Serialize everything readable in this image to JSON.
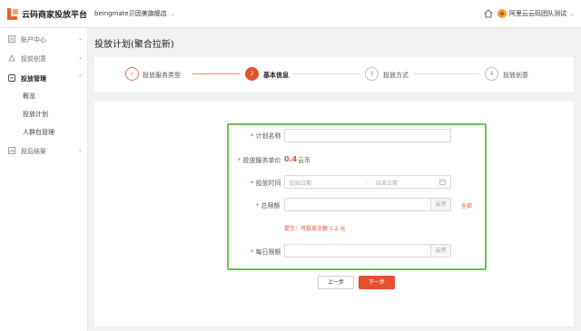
{
  "app": {
    "name": "云码商家投放平台"
  },
  "header": {
    "store_name": "beingmate贝因美旗舰店",
    "account_name": "阿里云云码团队测试"
  },
  "sidebar": {
    "groups": [
      {
        "label": "账户中心",
        "expanded": false
      },
      {
        "label": "投前创意",
        "expanded": false
      },
      {
        "label": "投放管理",
        "expanded": true,
        "items": [
          "概览",
          "投放计划",
          "人群包管理"
        ]
      },
      {
        "label": "投后结案",
        "expanded": false
      }
    ]
  },
  "page": {
    "title": "投放计划(聚合拉新)"
  },
  "steps": [
    {
      "number": "✓",
      "label": "投放服务类型",
      "status": "done"
    },
    {
      "number": "2",
      "label": "基本信息",
      "status": "current"
    },
    {
      "number": "3",
      "label": "投放方式",
      "status": "pending"
    },
    {
      "number": "4",
      "label": "投放创意",
      "status": "pending"
    }
  ],
  "form": {
    "plan_name": {
      "label": "计划名称",
      "value": ""
    },
    "unit_price": {
      "label": "投放服务单价",
      "value": "0.4",
      "unit": "云币"
    },
    "schedule": {
      "label": "投放时间",
      "start_placeholder": "起始日期",
      "separator": "-",
      "end_placeholder": "结束日期"
    },
    "total_limit": {
      "label": "总限额",
      "unit": "云币",
      "all_link": "全部",
      "hint": "提示：可投放余额 1.2 元"
    },
    "daily_limit": {
      "label": "每日限额",
      "unit": "云币"
    }
  },
  "buttons": {
    "prev": "上一步",
    "next": "下一步"
  },
  "colors": {
    "accent": "#e5502e",
    "highlight_border": "#6cc04a"
  }
}
